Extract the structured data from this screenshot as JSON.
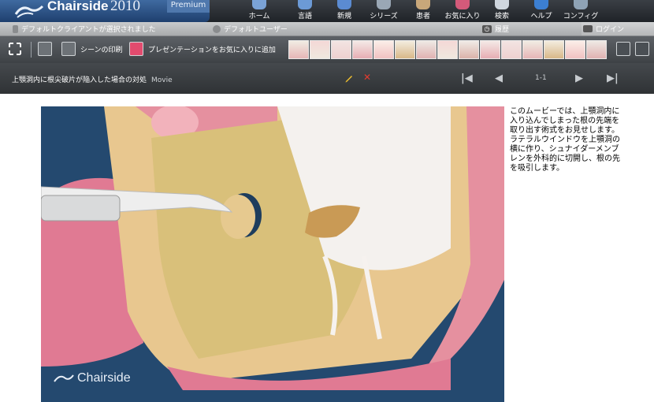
{
  "app": {
    "name": "Chairside",
    "year": "2010",
    "edition": "Premium"
  },
  "nav": {
    "items": [
      {
        "label": "ホーム",
        "icon": "home-icon",
        "color": "#7aa2d6"
      },
      {
        "label": "言語",
        "icon": "language-icon",
        "color": "#6c9ad6"
      },
      {
        "label": "新規",
        "icon": "new-icon",
        "color": "#5b8bd2"
      },
      {
        "label": "シリーズ",
        "icon": "series-icon",
        "color": "#9aa7b5"
      },
      {
        "label": "患者",
        "icon": "patient-icon",
        "color": "#c8a77a"
      },
      {
        "label": "お気に入り",
        "icon": "favorites-icon",
        "color": "#d45a7a"
      },
      {
        "label": "検索",
        "icon": "search-icon",
        "color": "#cfd6de"
      },
      {
        "label": "ヘルプ",
        "icon": "help-icon",
        "color": "#3c7fd2"
      },
      {
        "label": "コンフィグ",
        "icon": "config-icon",
        "color": "#8fa3b6"
      }
    ]
  },
  "status": {
    "client": "デフォルトクライアントが選択されました",
    "user": "デフォルトユーザー",
    "history": "履歴",
    "logout": "ログイン"
  },
  "toolbar": {
    "print_scene": "シーンの印刷",
    "add_favorite": "プレゼンテーションをお気に入りに追加",
    "thumbnail_count": 15
  },
  "title": {
    "text": "上顎洞内に根尖破片が陥入した場合の対処",
    "type_label": "Movie",
    "page_indicator": "1-1"
  },
  "content": {
    "description": "このムービーでは、上顎洞内に入り込んでしまった根の先端を取り出す術式をお見せします。ラテラルウインドウを上顎洞の横に作り、シュナイダーメンブレンを外科的に切開し、根の先を吸引します。",
    "watermark": "Chairside"
  }
}
